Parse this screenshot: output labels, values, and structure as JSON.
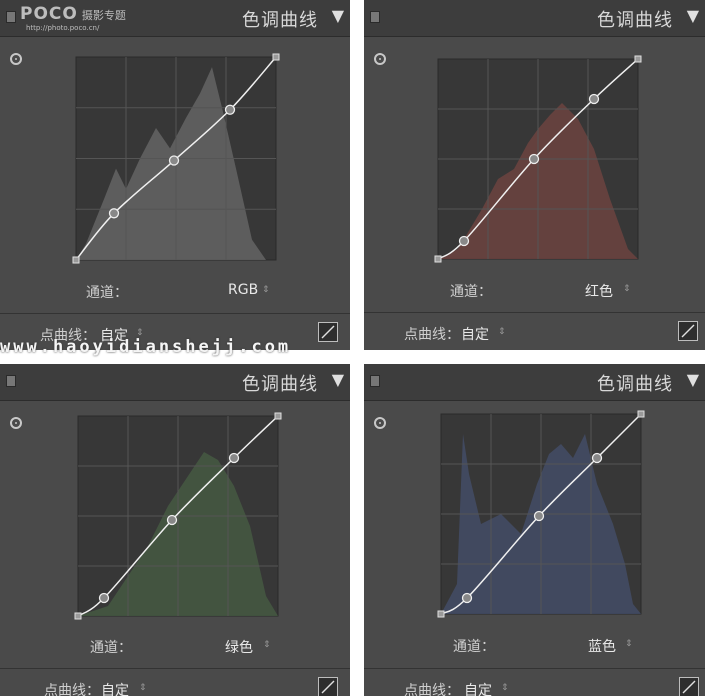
{
  "panel_title": "色调曲线",
  "channel_label": "通道：",
  "point_curve_label": "点曲线：",
  "point_curve_value": "自定",
  "stepper_glyph": "⇕",
  "collapse_glyph": "▼",
  "logo": {
    "brand": "POCO",
    "sub": "摄影专题",
    "url": "http://photo.poco.cn/"
  },
  "watermark": "www.haoyidianshejj.com",
  "panels": [
    {
      "channel": "RGB",
      "hist_color": "#7d7d7d",
      "points": [
        [
          0,
          0
        ],
        [
          0.19,
          0.23
        ],
        [
          0.49,
          0.49
        ],
        [
          0.77,
          0.74
        ],
        [
          1,
          1
        ]
      ]
    },
    {
      "channel": "红色",
      "hist_color": "#8a4a45",
      "points": [
        [
          0,
          0
        ],
        [
          0.13,
          0.09
        ],
        [
          0.48,
          0.5
        ],
        [
          0.78,
          0.8
        ],
        [
          1,
          1
        ]
      ]
    },
    {
      "channel": "绿色",
      "hist_color": "#4f6e48",
      "points": [
        [
          0,
          0
        ],
        [
          0.13,
          0.09
        ],
        [
          0.47,
          0.48
        ],
        [
          0.78,
          0.79
        ],
        [
          1,
          1
        ]
      ]
    },
    {
      "channel": "蓝色",
      "hist_color": "#4a5a82",
      "points": [
        [
          0,
          0
        ],
        [
          0.13,
          0.08
        ],
        [
          0.49,
          0.49
        ],
        [
          0.78,
          0.78
        ],
        [
          1,
          1
        ]
      ]
    }
  ]
}
